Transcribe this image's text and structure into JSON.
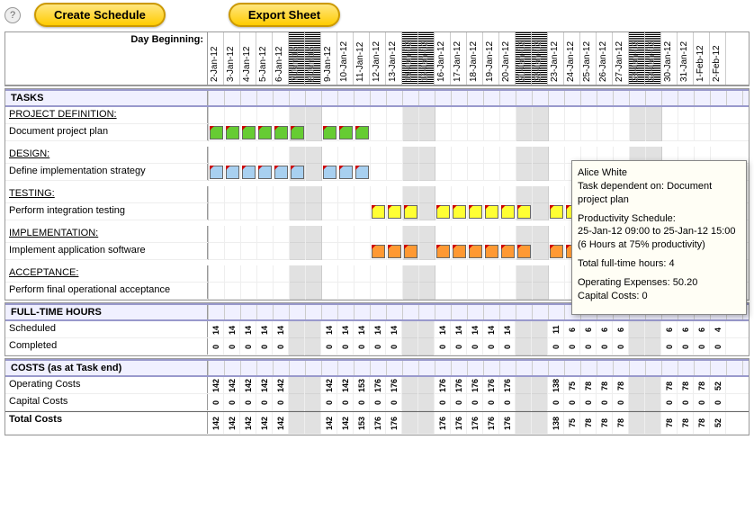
{
  "toolbar": {
    "help": "?",
    "create": "Create Schedule",
    "export": "Export Sheet"
  },
  "headerLabel": "Day Beginning:",
  "dates": [
    "2-Jan-12",
    "3-Jan-12",
    "4-Jan-12",
    "5-Jan-12",
    "6-Jan-12",
    "7-Jan-12",
    "8-Jan-12",
    "9-Jan-12",
    "10-Jan-12",
    "11-Jan-12",
    "12-Jan-12",
    "13-Jan-12",
    "14-Jan-12",
    "15-Jan-12",
    "16-Jan-12",
    "17-Jan-12",
    "18-Jan-12",
    "19-Jan-12",
    "20-Jan-12",
    "21-Jan-12",
    "22-Jan-12",
    "23-Jan-12",
    "24-Jan-12",
    "25-Jan-12",
    "26-Jan-12",
    "27-Jan-12",
    "28-Jan-12",
    "29-Jan-12",
    "30-Jan-12",
    "31-Jan-12",
    "1-Feb-12",
    "2-Feb-12"
  ],
  "weekends": [
    5,
    6,
    12,
    13,
    19,
    20,
    26,
    27
  ],
  "sections": {
    "tasks": "TASKS",
    "hours": "FULL-TIME HOURS",
    "costs": "COSTS (as at Task end)"
  },
  "taskGroups": [
    {
      "cat": "PROJECT DEFINITION:",
      "task": "Document project plan",
      "color": "c-green",
      "bars": [
        [
          0,
          5
        ],
        [
          7,
          9
        ]
      ]
    },
    {
      "cat": "DESIGN:",
      "task": "Define implementation strategy",
      "color": "c-blue",
      "bars": [
        [
          0,
          5
        ],
        [
          7,
          9
        ]
      ]
    },
    {
      "cat": "TESTING:",
      "task": "Perform integration testing",
      "color": "c-yellow",
      "bars": [
        [
          10,
          12
        ],
        [
          14,
          19
        ],
        [
          21,
          24
        ]
      ]
    },
    {
      "cat": "IMPLEMENTATION:",
      "task": "Implement application software",
      "color": "c-orange",
      "bars": [
        [
          10,
          12
        ],
        [
          14,
          19
        ],
        [
          21,
          22
        ]
      ]
    },
    {
      "cat": "ACCEPTANCE:",
      "task": "Perform final operational acceptance",
      "color": "c-red",
      "bars": [
        [
          23,
          26
        ],
        [
          28,
          31
        ]
      ]
    }
  ],
  "hoursRows": [
    {
      "label": "Scheduled",
      "vals": [
        "14",
        "14",
        "14",
        "14",
        "14",
        "",
        "",
        "14",
        "14",
        "14",
        "14",
        "14",
        "",
        "",
        "14",
        "14",
        "14",
        "14",
        "14",
        "",
        "",
        "11",
        "6",
        "6",
        "6",
        "6",
        "",
        "",
        "6",
        "6",
        "6",
        "4"
      ]
    },
    {
      "label": "Completed",
      "vals": [
        "0",
        "0",
        "0",
        "0",
        "0",
        "",
        "",
        "0",
        "0",
        "0",
        "0",
        "0",
        "",
        "",
        "0",
        "0",
        "0",
        "0",
        "0",
        "",
        "",
        "0",
        "0",
        "0",
        "0",
        "0",
        "",
        "",
        "0",
        "0",
        "0",
        "0"
      ]
    }
  ],
  "costsRows": [
    {
      "label": "Operating Costs",
      "vals": [
        "142",
        "142",
        "142",
        "142",
        "142",
        "",
        "",
        "142",
        "142",
        "153",
        "176",
        "176",
        "",
        "",
        "176",
        "176",
        "176",
        "176",
        "176",
        "",
        "",
        "138",
        "75",
        "78",
        "78",
        "78",
        "",
        "",
        "78",
        "78",
        "78",
        "52"
      ]
    },
    {
      "label": "Capital Costs",
      "vals": [
        "0",
        "0",
        "0",
        "0",
        "0",
        "",
        "",
        "0",
        "0",
        "0",
        "0",
        "0",
        "",
        "",
        "0",
        "0",
        "0",
        "0",
        "0",
        "",
        "",
        "0",
        "0",
        "0",
        "0",
        "0",
        "",
        "",
        "0",
        "0",
        "0",
        "0"
      ]
    }
  ],
  "totalRow": {
    "label": "Total Costs",
    "vals": [
      "142",
      "142",
      "142",
      "142",
      "142",
      "",
      "",
      "142",
      "142",
      "153",
      "176",
      "176",
      "",
      "",
      "176",
      "176",
      "176",
      "176",
      "176",
      "",
      "",
      "138",
      "75",
      "78",
      "78",
      "78",
      "",
      "",
      "78",
      "78",
      "78",
      "52"
    ]
  },
  "tooltip": {
    "name": "Alice White",
    "dep": "Task dependent on: Document project plan",
    "schedHdr": "Productivity Schedule:",
    "sched": "25-Jan-12 09:00 to 25-Jan-12 15:00 (6 Hours at 75% productivity)",
    "hours": "Total full-time hours: 4",
    "opex": "Operating Expenses: 50.20",
    "capex": "Capital Costs: 0"
  }
}
